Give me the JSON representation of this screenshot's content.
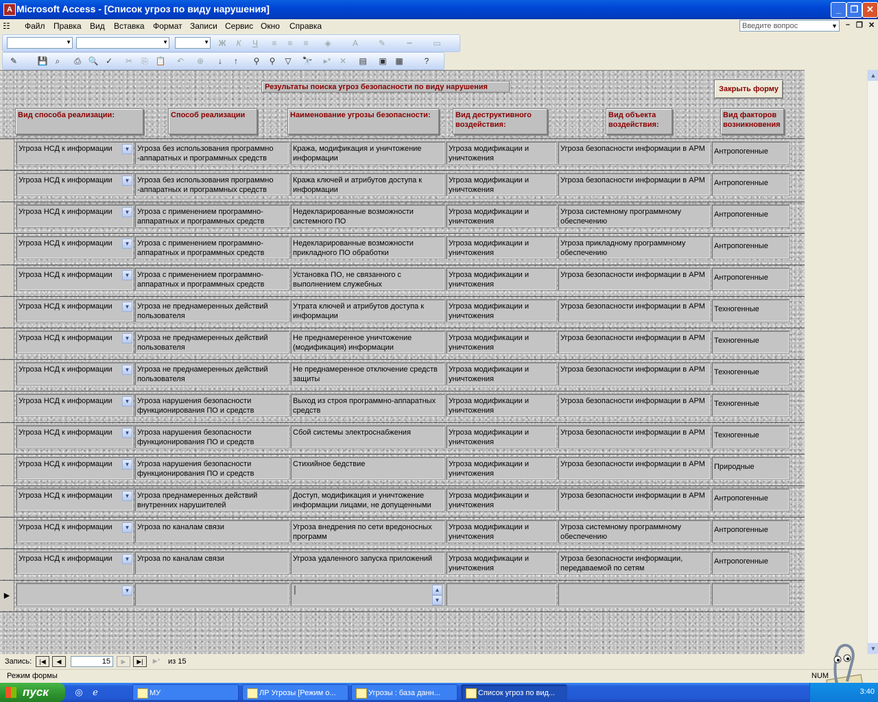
{
  "window": {
    "title": "Microsoft Access - [Список угроз по виду нарушения]"
  },
  "menu": [
    "Файл",
    "Правка",
    "Вид",
    "Вставка",
    "Формат",
    "Записи",
    "Сервис",
    "Окно",
    "Справка"
  ],
  "help_placeholder": "Введите вопрос",
  "form": {
    "title": "Результаты поиска угроз безопасности по виду нарушения",
    "close_button": "Закрыть форму",
    "columns": [
      "Вид способа реализации:",
      "Способ реализации",
      "Наименование угрозы безопасности:",
      "Вид деструктивного воздействия:",
      "Вид объекта воздействия:",
      "Вид факторов возникновения"
    ],
    "rows": [
      [
        "Угроза НСД к информации",
        "Угроза без использования программно -аппаратных и программных средств",
        "Кража, модификация и уничтожение информации",
        "Угроза модификации и уничтожения",
        "Угроза безопасности информации в АРМ",
        "Антропогенные"
      ],
      [
        "Угроза НСД к информации",
        "Угроза без использования программно -аппаратных и программных средств",
        "Кража ключей и атрибутов доступа к информации",
        "Угроза модификации и уничтожения",
        "Угроза безопасности информации в АРМ",
        "Антропогенные"
      ],
      [
        "Угроза НСД к информации",
        "Угроза с применением программно-аппаратных и программных средств",
        "Недекларированные возможности системного ПО",
        "Угроза модификации и уничтожения",
        "Угроза системному программному обеспечению",
        "Антропогенные"
      ],
      [
        "Угроза НСД к информации",
        "Угроза с применением программно-аппаратных и программных средств",
        "Недекларированные возможности прикладного ПО обработки",
        "Угроза модификации и уничтожения",
        "Угроза прикладному программному обеспечению",
        "Антропогенные"
      ],
      [
        "Угроза НСД к информации",
        "Угроза с применением программно-аппаратных и программных средств",
        "Установка ПО, не связанного с выполнением служебных",
        "Угроза модификации и уничтожения",
        "Угроза безопасности информации в АРМ",
        "Антропогенные"
      ],
      [
        "Угроза НСД к информации",
        "Угроза не преднамеренных действий пользователя",
        "Утрата ключей и атрибутов доступа к информации",
        "Угроза модификации и уничтожения",
        "Угроза безопасности информации в АРМ",
        "Техногенные"
      ],
      [
        "Угроза НСД к информации",
        "Угроза не преднамеренных действий пользователя",
        "Не преднамеренное уничтожение (модификация) информации",
        "Угроза модификации и уничтожения",
        "Угроза безопасности информации в АРМ",
        "Техногенные"
      ],
      [
        "Угроза НСД к информации",
        "Угроза не преднамеренных действий пользователя",
        "Не преднамеренное отключение средств защиты",
        "Угроза модификации и уничтожения",
        "Угроза безопасности информации в АРМ",
        "Техногенные"
      ],
      [
        "Угроза НСД к информации",
        "Угроза нарушения безопасности функционирования ПО и средств",
        "Выход из строя программно-аппаратных средств",
        "Угроза модификации и уничтожения",
        "Угроза безопасности информации в АРМ",
        "Техногенные"
      ],
      [
        "Угроза НСД к информации",
        "Угроза нарушения безопасности функционирования ПО и средств",
        "Сбой системы электроснабжения",
        "Угроза модификации и уничтожения",
        "Угроза безопасности информации в АРМ",
        "Техногенные"
      ],
      [
        "Угроза НСД к информации",
        "Угроза нарушения безопасности функционирования ПО и средств",
        "Стихийное бедствие",
        "Угроза модификации и уничтожения",
        "Угроза безопасности информации в АРМ",
        "Природные"
      ],
      [
        "Угроза НСД к информации",
        "Угроза преднамеренных действий внутренних нарушителей",
        "Доступ, модификация и уничтожение информации лицами, не допущенными",
        "Угроза модификации и уничтожения",
        "Угроза безопасности информации в АРМ",
        "Антропогенные"
      ],
      [
        "Угроза НСД к информации",
        "Угроза по каналам связи",
        "Угроза внедрения по сети вредоносных программ",
        "Угроза модификации и уничтожения",
        "Угроза системному программному обеспечению",
        "Антропогенные"
      ],
      [
        "Угроза НСД к информации",
        "Угроза по каналам связи",
        "Угроза удаленного запуска приложений",
        "Угроза модификации и уничтожения",
        "Угроза безопасности информации, передаваемой по сетям",
        "Антропогенные"
      ]
    ]
  },
  "navigation": {
    "label": "Запись:",
    "current": "15",
    "of_text": "из  15"
  },
  "status": {
    "mode": "Режим формы",
    "indicator": "NUM"
  },
  "taskbar": {
    "start": "пуск",
    "tasks": [
      "МУ",
      "ЛР Угрозы [Режим о...",
      "Угрозы : база данн...",
      "Список угроз по вид..."
    ],
    "clock": "3:40"
  },
  "colors": {
    "header_text": "#8b0000",
    "title_bar": "#0046d5",
    "form_bg": "#bdbdbd"
  }
}
